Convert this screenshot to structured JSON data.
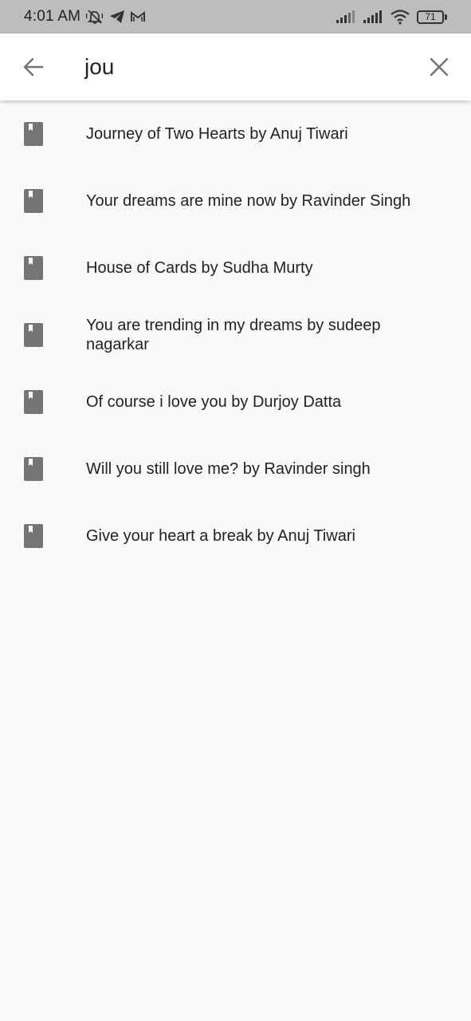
{
  "status_bar": {
    "time": "4:01 AM",
    "icons": [
      "mute-icon",
      "telegram-icon",
      "gmail-icon",
      "signal-icon",
      "signal-icon",
      "wifi-icon"
    ],
    "battery": "71"
  },
  "search": {
    "query": "jou",
    "back_icon": "arrow-back-icon",
    "clear_icon": "close-icon"
  },
  "results": [
    {
      "label": "Journey of Two Hearts by Anuj Tiwari",
      "icon": "book-icon"
    },
    {
      "label": "Your dreams are mine now by Ravinder Singh",
      "icon": "book-icon"
    },
    {
      "label": "House of Cards by Sudha Murty",
      "icon": "book-icon"
    },
    {
      "label": "You are trending in my dreams by sudeep nagarkar",
      "icon": "book-icon"
    },
    {
      "label": "Of course i love you by Durjoy Datta",
      "icon": "book-icon"
    },
    {
      "label": "Will you still love me? by Ravinder singh",
      "icon": "book-icon"
    },
    {
      "label": "Give your heart a break by Anuj Tiwari",
      "icon": "book-icon"
    }
  ],
  "colors": {
    "status_bar_bg": "#bdbdbd",
    "app_bar_bg": "#ffffff",
    "page_bg": "#fafafa",
    "icon_gray": "#757575"
  }
}
